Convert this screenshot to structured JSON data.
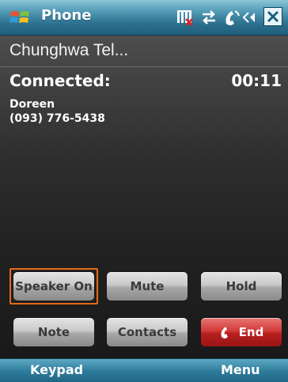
{
  "titlebar": {
    "title": "Phone",
    "icons": [
      "windows-start-icon",
      "signal-off-icon",
      "data-sync-icon",
      "phone-call-icon",
      "volume-icon",
      "close-icon"
    ]
  },
  "call": {
    "carrier": "Chunghwa Tel...",
    "status": "Connected:",
    "timer": "00:11",
    "contact_name": "Doreen",
    "contact_number": "(093) 776-5438"
  },
  "buttons": {
    "speaker": "Speaker On",
    "mute": "Mute",
    "hold": "Hold",
    "note": "Note",
    "contacts": "Contacts",
    "end": "End"
  },
  "softkeys": {
    "left": "Keypad",
    "right": "Menu"
  },
  "colors": {
    "titlebar": "#2b6e8d",
    "end_button": "#d33a3a",
    "focus_ring": "#e46a1a"
  }
}
